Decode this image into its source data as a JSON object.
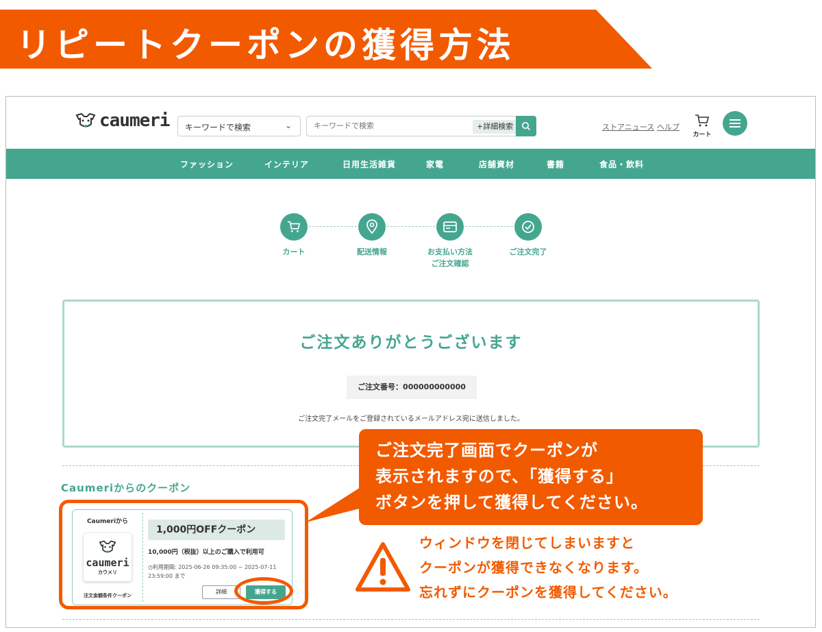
{
  "banner": {
    "title": "リピートクーポンの獲得方法"
  },
  "header": {
    "logo_text": "caumeri",
    "search_select": "キーワードで検索",
    "search_placeholder": "キーワードで検索",
    "advanced_search": "+詳細検索",
    "links": [
      "ストアニュース",
      "ヘルプ"
    ],
    "cart_label": "カート"
  },
  "nav": {
    "items": [
      "ファッション",
      "インテリア",
      "日用生活雑貨",
      "家電",
      "店舗資材",
      "書籍",
      "食品・飲料"
    ]
  },
  "steps": [
    {
      "label": "カート",
      "icon": "cart-icon"
    },
    {
      "label": "配送情報",
      "icon": "location-pin-icon"
    },
    {
      "label": "お支払い方法\nご注文確認",
      "icon": "card-icon"
    },
    {
      "label": "ご注文完了",
      "icon": "check-icon"
    }
  ],
  "thanks": {
    "title": "ご注文ありがとうございます",
    "order_number": "ご注文番号：000000000000",
    "mail_note": "ご注文完了メールをご登録されているメールアドレス宛に送信しました。"
  },
  "coupon_section": {
    "heading": "Caumeriからのクーポン"
  },
  "coupon": {
    "from": "Caumeriから",
    "logo_text": "caumeri",
    "logo_kana": "カウメリ",
    "condition_tag": "注文金額条件クーポン",
    "name": "1,000円OFFクーポン",
    "condition": "10,000円（税抜）以上のご購入で利用可",
    "period": "◷利用期間: 2025-06-26 09:35:00 ~ 2025-07-11 23:59:00 まで",
    "detail_label": "詳細",
    "get_label": "獲得する"
  },
  "callout": {
    "text": "ご注文完了画面でクーポンが\n表示されますので、「獲得する」\nボタンを押して獲得してください。"
  },
  "warning": {
    "text": "ウィンドウを閉じてしまいますと\nクーポンが獲得できなくなります。\n忘れずにクーポンを獲得してください。"
  },
  "colors": {
    "accent_orange": "#f25a00",
    "brand_green": "#45a68f"
  }
}
